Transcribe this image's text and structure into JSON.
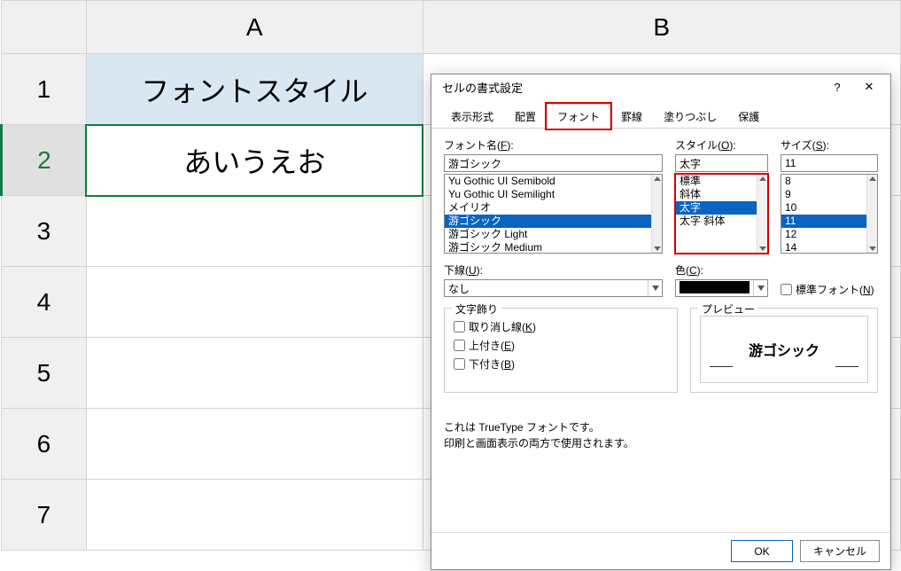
{
  "spreadsheet": {
    "columns": [
      "A",
      "B"
    ],
    "rows": [
      "1",
      "2",
      "3",
      "4",
      "5",
      "6",
      "7"
    ],
    "cells": {
      "A1": "フォントスタイル",
      "A2": "あいうえお"
    },
    "selected_cell": "A2"
  },
  "dialog": {
    "title": "セルの書式設定",
    "help_glyph": "?",
    "close_glyph": "✕",
    "tabs": [
      "表示形式",
      "配置",
      "フォント",
      "罫線",
      "塗りつぶし",
      "保護"
    ],
    "active_tab": "フォント",
    "font": {
      "label_html": "フォント名(<u class='key'>F</u>):",
      "value": "游ゴシック",
      "items": [
        "Yu Gothic UI Semibold",
        "Yu Gothic UI Semilight",
        "メイリオ",
        "游ゴシック",
        "游ゴシック Light",
        "游ゴシック Medium"
      ],
      "selected": "游ゴシック"
    },
    "style": {
      "label_html": "スタイル(<u class='key'>O</u>):",
      "value": "太字",
      "items": [
        "標準",
        "斜体",
        "太字",
        "太字 斜体"
      ],
      "selected": "太字"
    },
    "size": {
      "label_html": "サイズ(<u class='key'>S</u>):",
      "value": "11",
      "items": [
        "8",
        "9",
        "10",
        "11",
        "12",
        "14"
      ],
      "selected": "11"
    },
    "underline": {
      "label_html": "下線(<u class='key'>U</u>):",
      "value": "なし"
    },
    "color": {
      "label_html": "色(<u class='key'>C</u>):",
      "value": "#000000"
    },
    "normal_font": {
      "label_html": "標準フォント(<u class='key'>N</u>)"
    },
    "decoration": {
      "title": "文字飾り",
      "strike_html": "取り消し線(<u class='key'>K</u>)",
      "super_html": "上付き(<u class='key'>E</u>)",
      "sub_html": "下付き(<u class='key'>B</u>)"
    },
    "preview": {
      "title": "プレビュー",
      "sample": "游ゴシック"
    },
    "hint": {
      "line1": "これは TrueType フォントです。",
      "line2": "印刷と画面表示の両方で使用されます。"
    },
    "buttons": {
      "ok": "OK",
      "cancel": "キャンセル"
    }
  }
}
